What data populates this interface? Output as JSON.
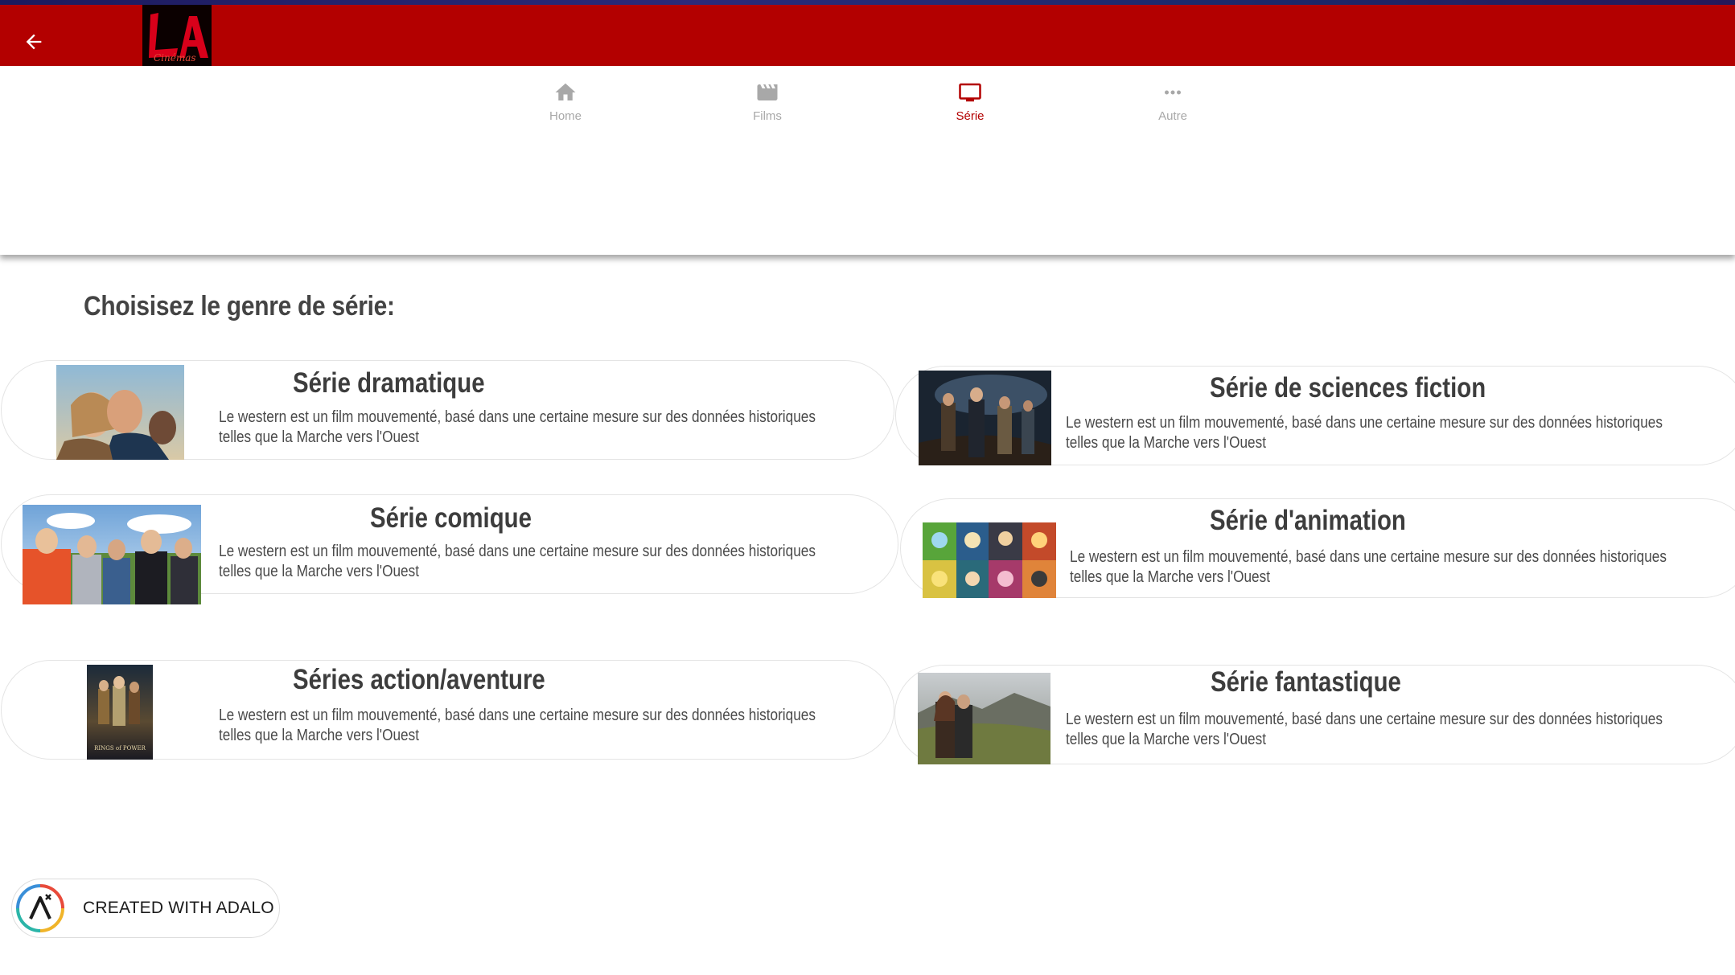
{
  "colors": {
    "header_bg": "#b30000",
    "active_tab": "#b30000",
    "inactive_tab": "#a8a8a8",
    "title_text": "#444444"
  },
  "header": {
    "back_icon": "arrow-left-icon",
    "logo_text": "LA",
    "logo_subtext": "Cinémas"
  },
  "tabs": [
    {
      "label": "Home",
      "icon": "home-icon",
      "active": false
    },
    {
      "label": "Films",
      "icon": "clapperboard-icon",
      "active": false
    },
    {
      "label": "Série",
      "icon": "tv-icon",
      "active": true
    },
    {
      "label": "Autre",
      "icon": "more-horizontal-icon",
      "active": false
    }
  ],
  "page": {
    "title": "Choisisez le genre de série:"
  },
  "genres": [
    {
      "title": "Série dramatique",
      "description": "Le western est un film mouvementé, basé dans une certaine mesure sur des données historiques telles que la Marche vers l'Ouest"
    },
    {
      "title": "Série de sciences fiction",
      "description": "Le western est un film mouvementé, basé dans une certaine mesure sur des données historiques telles que la Marche vers l'Ouest"
    },
    {
      "title": "Série comique",
      "description": "Le western est un film mouvementé, basé dans une certaine mesure sur des données historiques telles que la Marche vers l'Ouest"
    },
    {
      "title": "Série d'animation",
      "description": "Le western est un film mouvementé, basé dans une certaine mesure sur des données historiques telles que la Marche vers l'Ouest"
    },
    {
      "title": "Séries action/aventure",
      "description": "Le western est un film mouvementé, basé dans une certaine mesure sur des données historiques telles que la Marche vers l'Ouest"
    },
    {
      "title": "Série fantastique",
      "description": "Le western est un film mouvementé, basé dans une certaine mesure sur des données historiques telles que la Marche vers l'Ouest"
    }
  ],
  "badge": {
    "label": "CREATED WITH ADALO"
  }
}
